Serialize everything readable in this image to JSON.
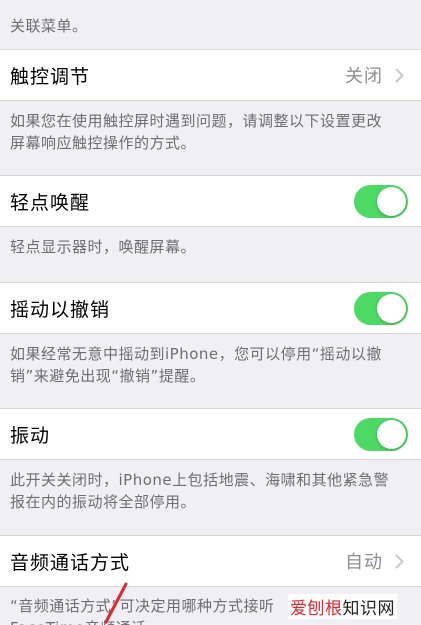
{
  "top_footer": {
    "line1": "",
    "line2": "关联菜单。"
  },
  "touch_accommodations": {
    "label": "触控调节",
    "value": "关闭",
    "footer_line1": "如果您在使用触控屏时遇到问题，请调整以下设置更改",
    "footer_line2": "屏幕响应触控操作的方式。"
  },
  "tap_to_wake": {
    "label": "轻点唤醒",
    "on": true,
    "footer": "轻点显示器时，唤醒屏幕。"
  },
  "shake_to_undo": {
    "label": "摇动以撤销",
    "on": true,
    "footer_line1": "如果经常无意中摇动到iPhone，您可以停用“摇动以撤",
    "footer_line2": "销”来避免出现“撤销”提醒。"
  },
  "vibration": {
    "label": "振动",
    "on": true,
    "footer_line1": "此开关关闭时，iPhone上包括地震、海啸和其他紧急警",
    "footer_line2": "报在内的振动将全部停用。"
  },
  "call_audio_routing": {
    "label": "音频通话方式",
    "value": "自动",
    "footer_line1": "“音频通话方式”可决定用哪种方式接听",
    "footer_line2": "FaceTime音频通话。"
  },
  "watermark": {
    "red": "爱刨根",
    "black": "知识网"
  },
  "colors": {
    "toggle_on": "#4cd964",
    "background": "#efeff4",
    "footer_text": "#6d6d72",
    "value_text": "#8e8e93",
    "annotation_arrow": "#e0282d"
  }
}
